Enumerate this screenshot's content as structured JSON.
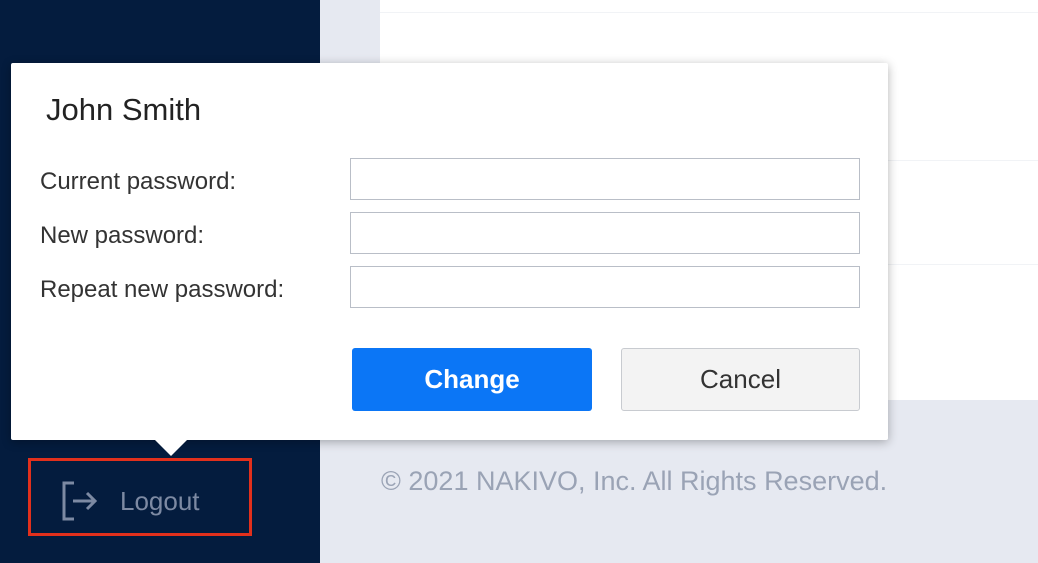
{
  "dialog": {
    "title": "John Smith",
    "fields": [
      {
        "label": "Current password:",
        "value": ""
      },
      {
        "label": "New password:",
        "value": ""
      },
      {
        "label": "Repeat new password:",
        "value": ""
      }
    ],
    "change_label": "Change",
    "cancel_label": "Cancel"
  },
  "sidebar": {
    "logout_label": "Logout",
    "logout_icon": "logout-icon"
  },
  "footer": {
    "copyright": "© 2021 NAKIVO, Inc. All Rights Reserved."
  },
  "colors": {
    "sidebar_bg": "#041c3e",
    "primary": "#0b76f6",
    "highlight": "#e2301c",
    "page_bg": "#e6e9f1"
  }
}
